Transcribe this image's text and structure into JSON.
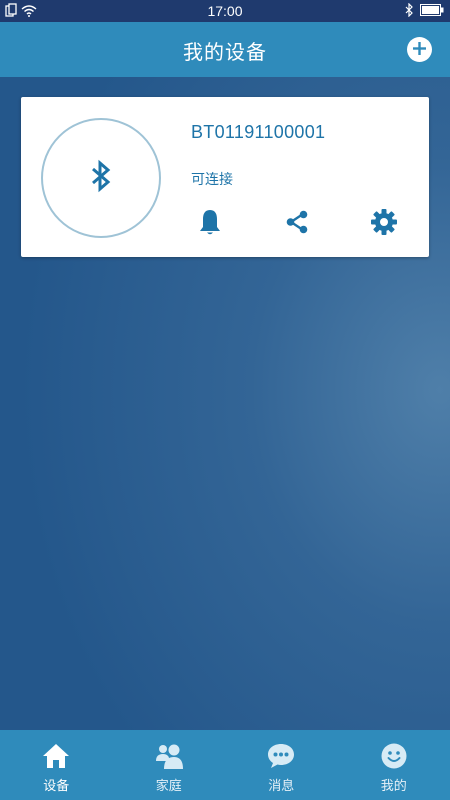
{
  "status_bar": {
    "time": "17:00",
    "icons": [
      "sim-icon",
      "wifi-icon",
      "bluetooth-icon",
      "battery-icon"
    ]
  },
  "header": {
    "title": "我的设备",
    "add_icon": "plus-circle-icon"
  },
  "device": {
    "name": "BT01191100001",
    "status": "可连接",
    "icon": "bluetooth-icon",
    "actions": [
      "bell-icon",
      "share-icon",
      "gear-icon"
    ]
  },
  "bottom_nav": {
    "items": [
      {
        "label": "设备",
        "icon": "home-icon",
        "active": true
      },
      {
        "label": "家庭",
        "icon": "family-icon",
        "active": false
      },
      {
        "label": "消息",
        "icon": "message-icon",
        "active": false
      },
      {
        "label": "我的",
        "icon": "smiley-icon",
        "active": false
      }
    ]
  },
  "colors": {
    "status_bar": "#1f3a6e",
    "header": "#2f8bbb",
    "background": "#24578b",
    "card": "#ffffff",
    "accent": "#1e74a8",
    "bt_ring": "#9fc3d6"
  }
}
